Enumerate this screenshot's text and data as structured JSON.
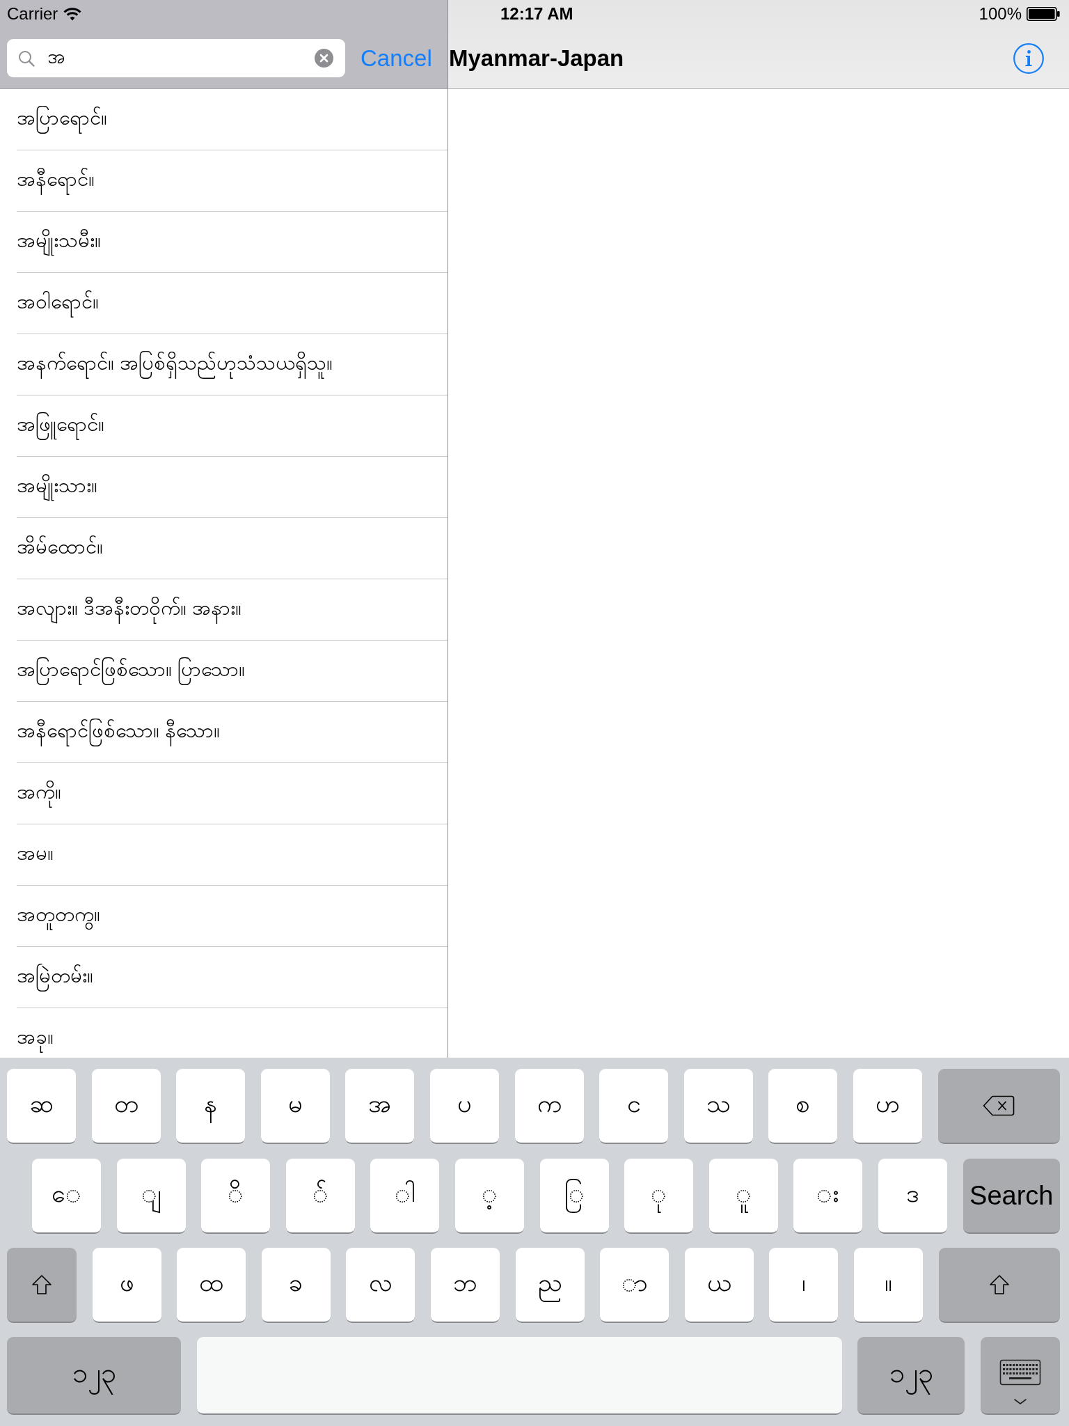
{
  "status_bar": {
    "carrier": "Carrier",
    "time": "12:17 AM",
    "battery": "100%"
  },
  "search": {
    "value": "အ",
    "cancel": "Cancel"
  },
  "results": [
    "အပြာရောင်။",
    "အနီရောင်။",
    "အမျိုးသမီး။",
    "အဝါရောင်။",
    "အနက်ရောင်။ အပြစ်ရှိသည်ဟုသံသယရှိသူ။",
    "အဖြူရောင်။",
    "အမျိုးသား။",
    "အိမ်ထောင်။",
    "အလျား။ ဒီအနီးတဝိုက်။ အနား။",
    "အပြာရောင်ဖြစ်သော။ ပြာသော။",
    "အနီရောင်ဖြစ်သော။ နီသော။",
    "အကို။",
    "အမ။",
    "အတူတကွ။",
    "အမြဲတမ်း။",
    "အခု။"
  ],
  "detail": {
    "title": "Myanmar-Japan"
  },
  "keyboard": {
    "rows": [
      [
        {
          "kind": "char",
          "label": "ဆ"
        },
        {
          "kind": "char",
          "label": "တ"
        },
        {
          "kind": "char",
          "label": "န"
        },
        {
          "kind": "char",
          "label": "မ"
        },
        {
          "kind": "char",
          "label": "အ"
        },
        {
          "kind": "char",
          "label": "ပ"
        },
        {
          "kind": "char",
          "label": "က"
        },
        {
          "kind": "char",
          "label": "င"
        },
        {
          "kind": "char",
          "label": "သ"
        },
        {
          "kind": "char",
          "label": "စ"
        },
        {
          "kind": "char",
          "label": "ဟ"
        },
        {
          "kind": "delete"
        }
      ],
      [
        {
          "kind": "char",
          "label": "ေ"
        },
        {
          "kind": "char",
          "label": "ျ"
        },
        {
          "kind": "char",
          "label": "ိ"
        },
        {
          "kind": "char",
          "label": "်"
        },
        {
          "kind": "char",
          "label": "ါ"
        },
        {
          "kind": "char",
          "label": "့"
        },
        {
          "kind": "char",
          "label": "ြ"
        },
        {
          "kind": "char",
          "label": "ု"
        },
        {
          "kind": "char",
          "label": "ူ"
        },
        {
          "kind": "char",
          "label": "း"
        },
        {
          "kind": "char",
          "label": "ဒ"
        },
        {
          "kind": "search",
          "label": "Search"
        }
      ],
      [
        {
          "kind": "shift"
        },
        {
          "kind": "char",
          "label": "ဖ"
        },
        {
          "kind": "char",
          "label": "ထ"
        },
        {
          "kind": "char",
          "label": "ခ"
        },
        {
          "kind": "char",
          "label": "လ"
        },
        {
          "kind": "char",
          "label": "ဘ"
        },
        {
          "kind": "char",
          "label": "ည"
        },
        {
          "kind": "char",
          "label": "ာ"
        },
        {
          "kind": "char",
          "label": "ယ"
        },
        {
          "kind": "char",
          "label": "၊"
        },
        {
          "kind": "char",
          "label": "။"
        },
        {
          "kind": "shift"
        }
      ],
      [
        {
          "kind": "numbers",
          "label": "၁၂၃"
        },
        {
          "kind": "space"
        },
        {
          "kind": "numbers",
          "label": "၁၂၃"
        },
        {
          "kind": "dismiss"
        }
      ]
    ]
  }
}
